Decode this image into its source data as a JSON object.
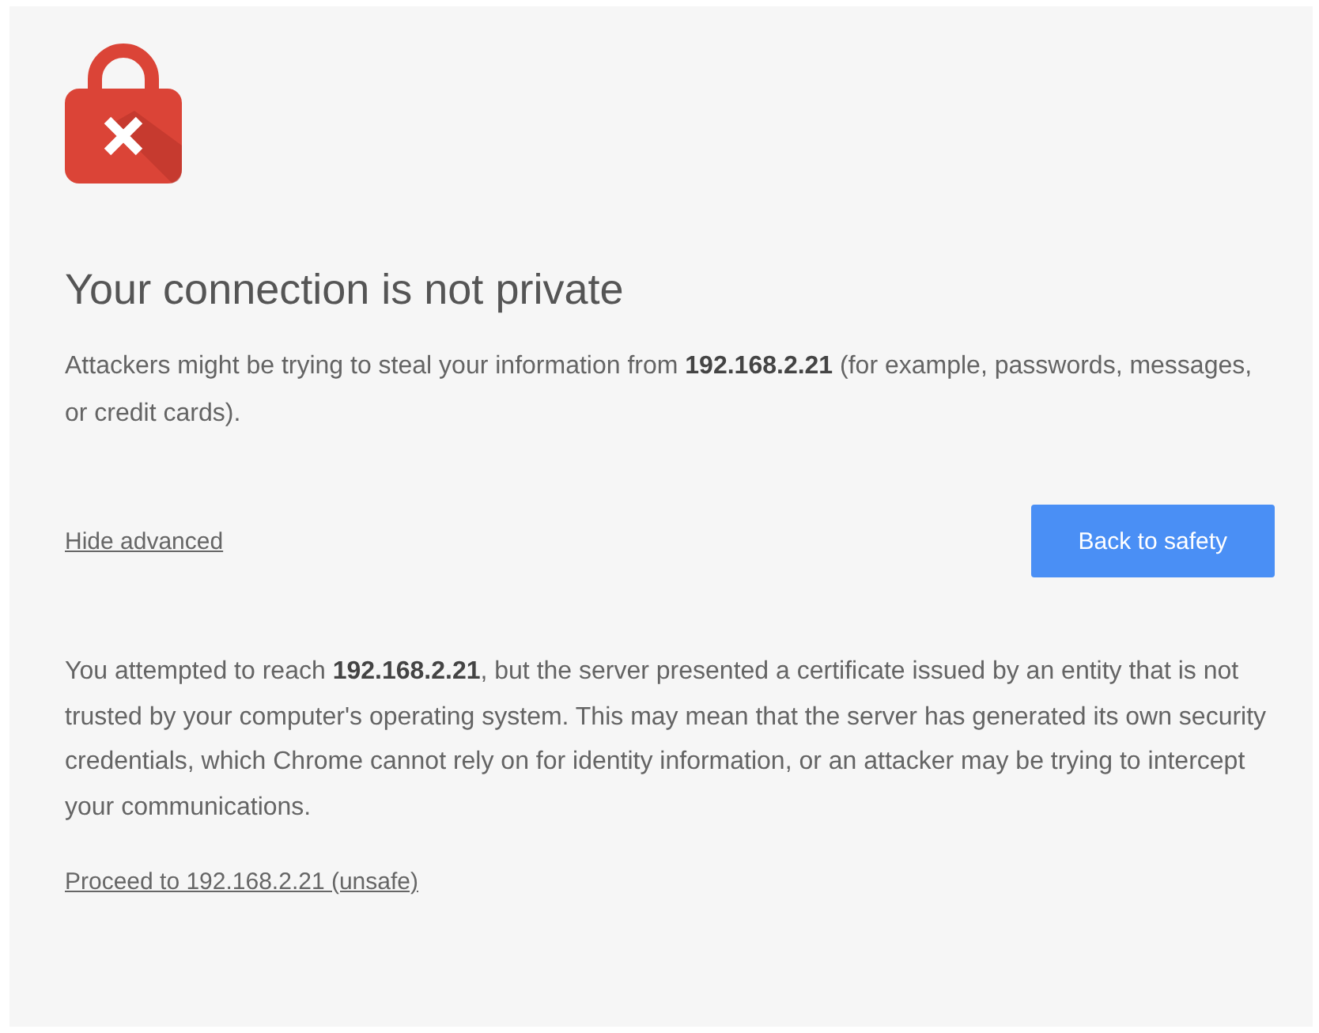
{
  "heading": "Your connection is not private",
  "summary": "Attackers might be trying to steal your information from **192.168.2.21** (for example, passwords, messages, or credit cards).",
  "hide_advanced_link": "Hide advanced",
  "back_button": "Back to safety",
  "details": "You attempted to reach **192.168.2.21**, but the server presented a certificate issued by an entity that is not trusted by your computer's operating system. This may mean that the server has generated its own security credentials, which Chrome cannot rely on for identity information, or an attacker may be trying to intercept your communications.",
  "proceed_link": "Proceed to 192.168.2.21 (unsafe)"
}
